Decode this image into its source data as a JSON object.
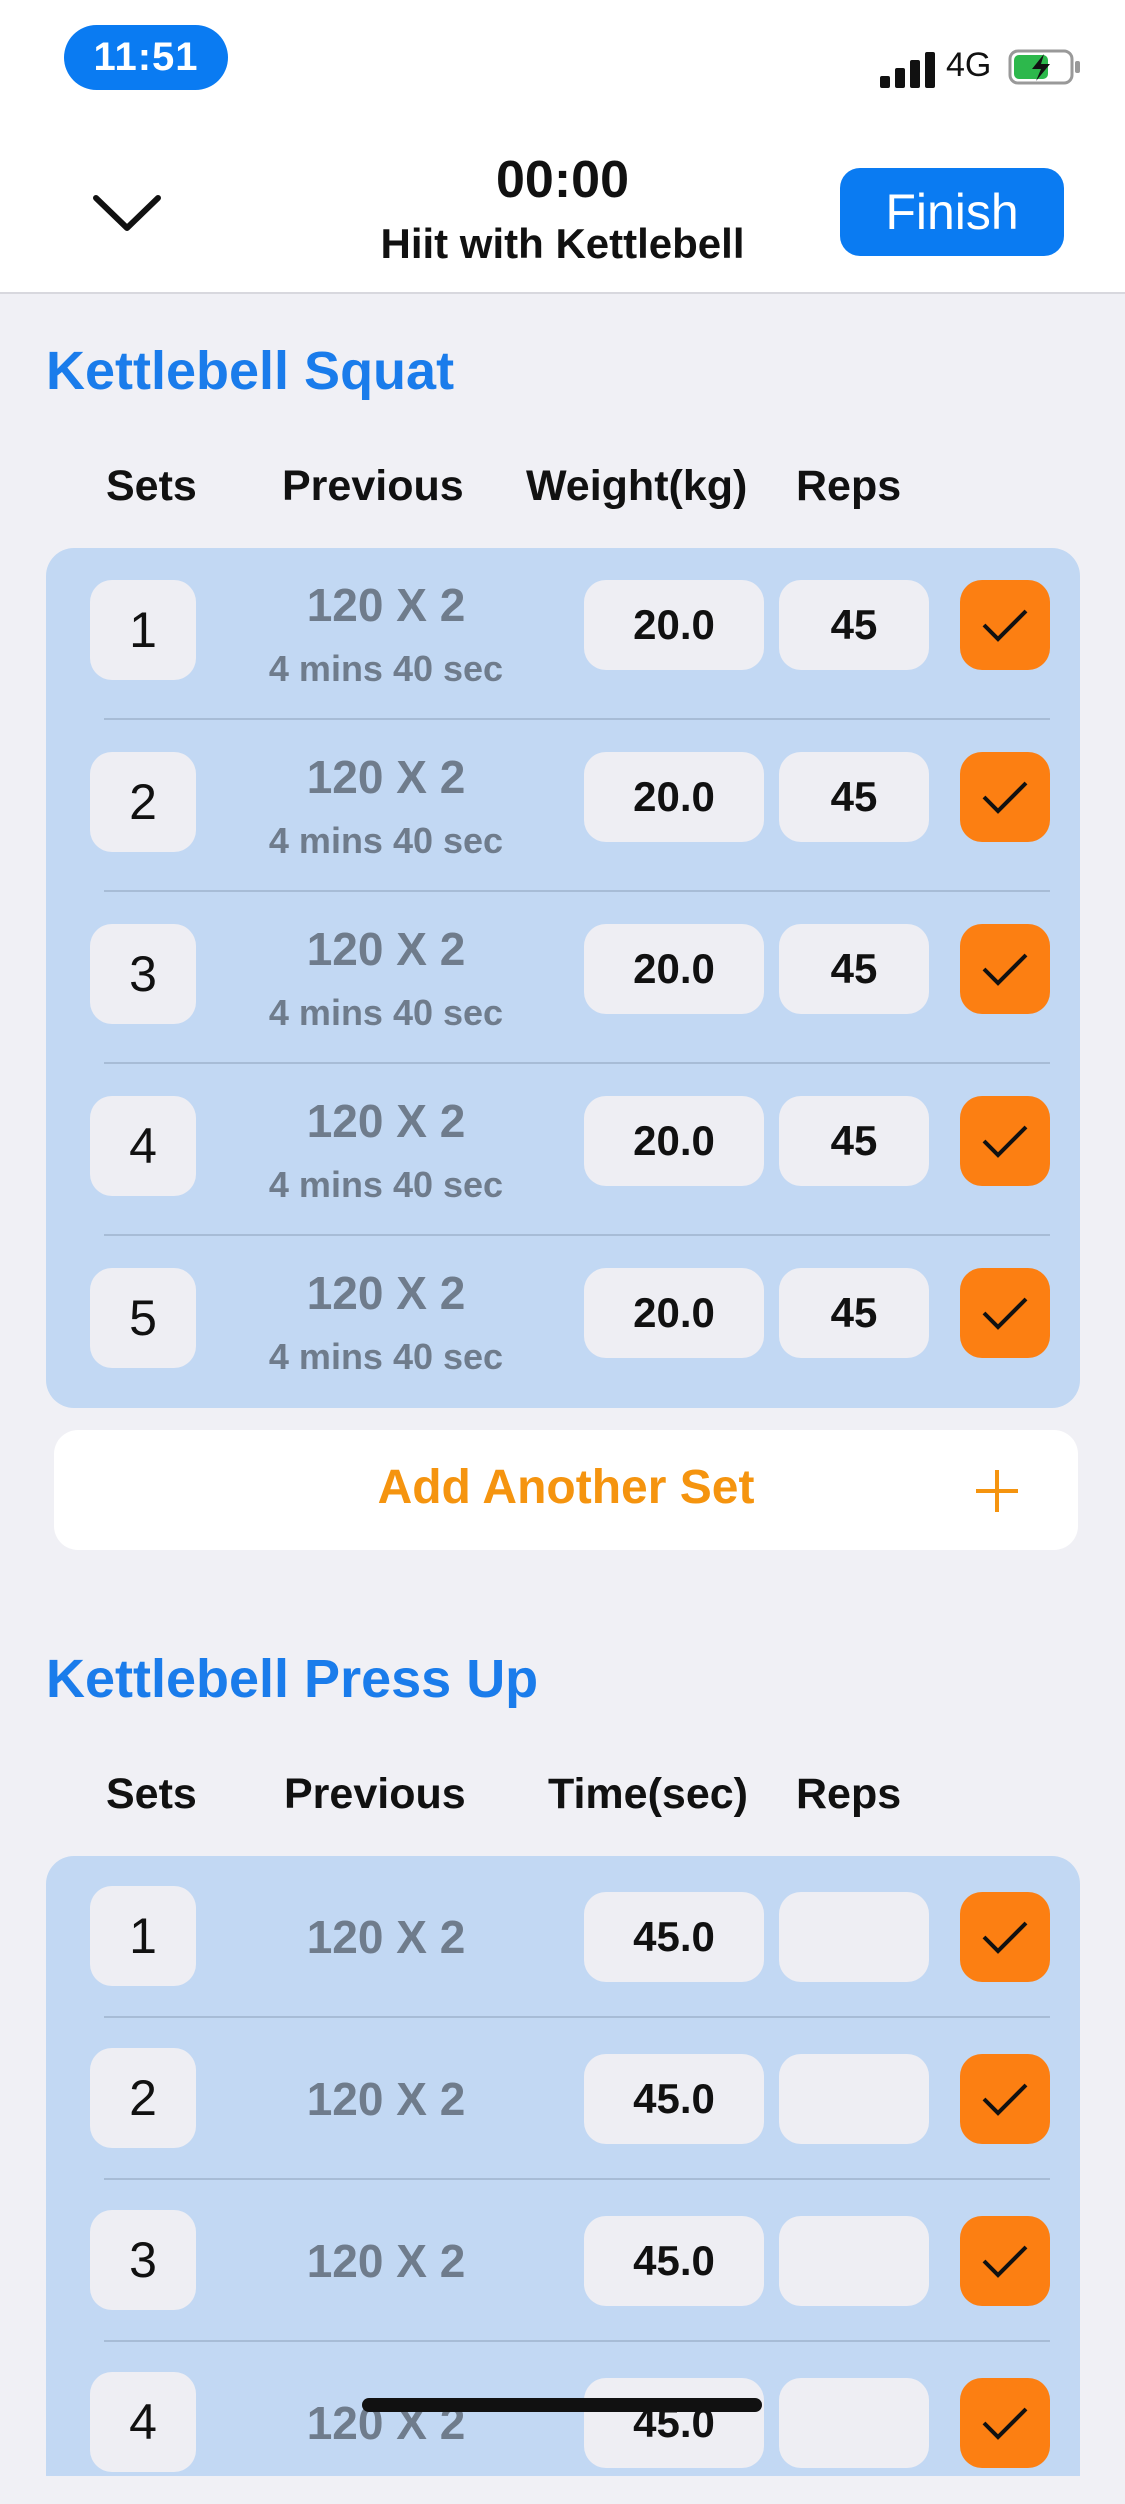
{
  "status_bar": {
    "time": "11:51",
    "network": "4G",
    "battery_color": "#2DB84C"
  },
  "header": {
    "back_icon": "chevron-down-icon",
    "timer": "00:00",
    "workout_title": "Hiit with Kettlebell",
    "finish_label": "Finish"
  },
  "colors": {
    "accent": "#1A7CEB",
    "check": "#FC7F12",
    "add_set": "#F5940F",
    "card": "#C2D8F3"
  },
  "exercise1": {
    "title": "Kettlebell Squat",
    "col_sets": "Sets",
    "col_previous": "Previous",
    "col_value": "Weight(kg)",
    "col_reps": "Reps",
    "sets": [
      {
        "num": "1",
        "previous": "120 X 2",
        "previous_sub": "4 mins 40 sec",
        "value": "20.0",
        "reps": "45"
      },
      {
        "num": "2",
        "previous": "120 X 2",
        "previous_sub": "4 mins 40 sec",
        "value": "20.0",
        "reps": "45"
      },
      {
        "num": "3",
        "previous": "120 X 2",
        "previous_sub": "4 mins 40 sec",
        "value": "20.0",
        "reps": "45"
      },
      {
        "num": "4",
        "previous": "120 X 2",
        "previous_sub": "4 mins 40 sec",
        "value": "20.0",
        "reps": "45"
      },
      {
        "num": "5",
        "previous": "120 X 2",
        "previous_sub": "4 mins 40 sec",
        "value": "20.0",
        "reps": "45"
      }
    ],
    "add_set_label": "Add Another Set"
  },
  "exercise2": {
    "title": "Kettlebell Press Up",
    "col_sets": "Sets",
    "col_previous": "Previous",
    "col_value": "Time(sec)",
    "col_reps": "Reps",
    "sets": [
      {
        "num": "1",
        "previous": "120 X 2",
        "value": "45.0",
        "reps": ""
      },
      {
        "num": "2",
        "previous": "120 X 2",
        "value": "45.0",
        "reps": ""
      },
      {
        "num": "3",
        "previous": "120 X 2",
        "value": "45.0",
        "reps": ""
      },
      {
        "num": "4",
        "previous": "120 X 2",
        "value": "45.0",
        "reps": ""
      }
    ]
  }
}
